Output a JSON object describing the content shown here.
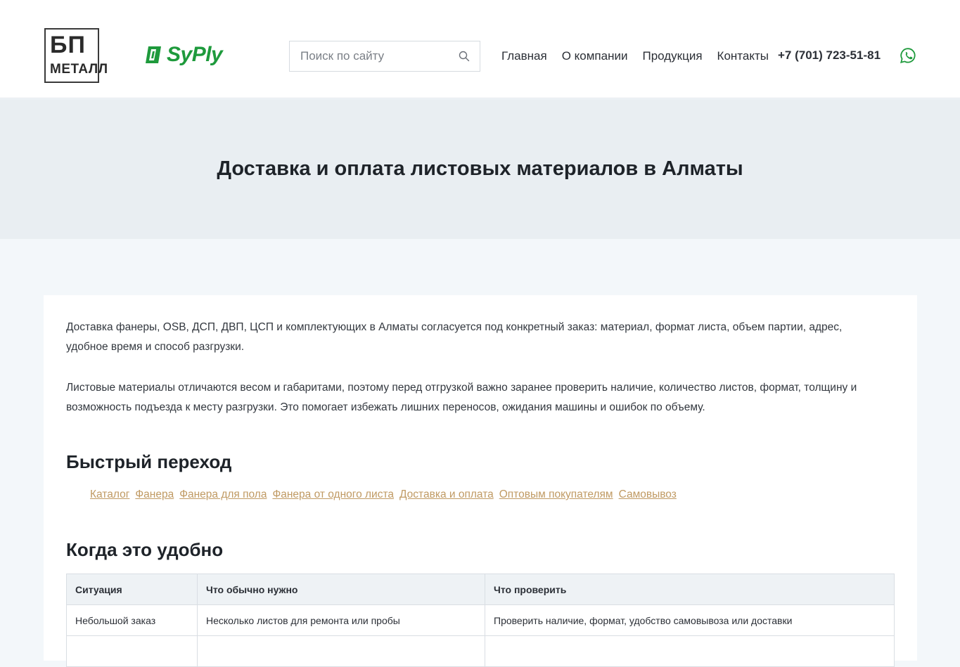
{
  "header": {
    "logo_bp_big": "БП",
    "logo_bp_small": "МЕТАЛЛ",
    "logo_syply": "SyPly",
    "search_placeholder": "Поиск по сайту",
    "nav": [
      "Главная",
      "О компании",
      "Продукция",
      "Контакты"
    ],
    "phone": "+7 (701) 723-51-81"
  },
  "hero": {
    "title": "Доставка и оплата листовых материалов в Алматы"
  },
  "content": {
    "p1": "Доставка фанеры, OSB, ДСП, ДВП, ЦСП и комплектующих в Алматы согласуется под конкретный заказ: материал, формат листа, объем партии, адрес, удобное время и способ разгрузки.",
    "p2": "Листовые материалы отличаются весом и габаритами, поэтому перед отгрузкой важно заранее проверить наличие, количество листов, формат, толщину и возможность подъезда к месту разгрузки. Это помогает избежать лишних переносов, ожидания машины и ошибок по объему.",
    "quick_title": "Быстрый переход",
    "quick_links": [
      "Каталог",
      "Фанера",
      "Фанера для пола",
      "Фанера от одного листа",
      "Доставка и оплата",
      "Оптовым покупателям",
      "Самовывоз"
    ],
    "when_title": "Когда это удобно",
    "table": {
      "headers": [
        "Ситуация",
        "Что обычно нужно",
        "Что проверить"
      ],
      "rows": [
        [
          "Небольшой заказ",
          "Несколько листов для ремонта или пробы",
          "Проверить наличие, формат, удобство самовывоза или доставки"
        ],
        [
          "",
          "",
          ""
        ]
      ]
    }
  },
  "colors": {
    "accent_green": "#1e9a3c",
    "link_gold": "#c09a63",
    "whatsapp": "#1e9a3c"
  }
}
